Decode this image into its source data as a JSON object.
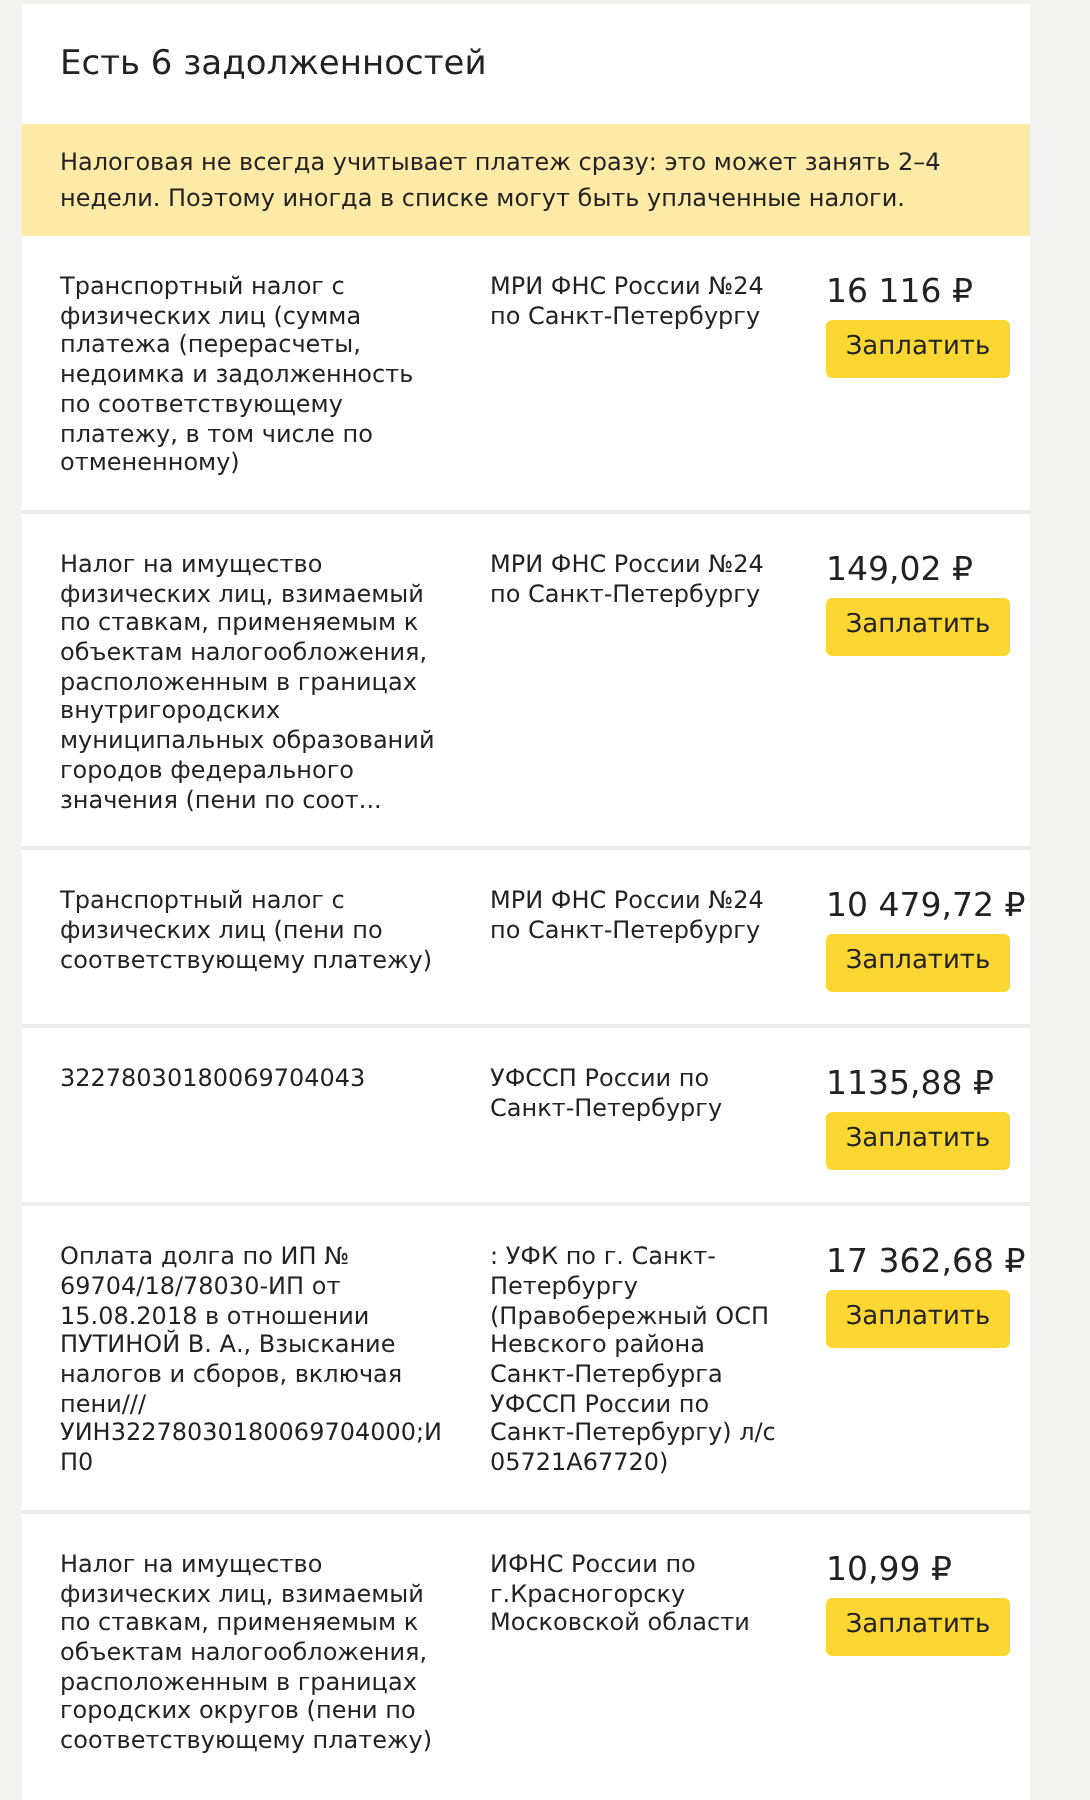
{
  "title": "Есть 6 задолженностей",
  "notice": "Налоговая не всегда учитывает платеж сразу: это может занять 2–4 недели. Поэтому иногда в списке могут быть уплаченные налоги.",
  "debts": [
    {
      "description": "Транспортный налог с физических лиц (сумма платежа (перерасчеты, недоимка и задолженность по соответствующему платежу, в том числе по отмененному)",
      "recipient": "МРИ ФНС России №24 по Санкт-Петербургу",
      "amount": "16 116 ₽",
      "button": "Заплатить"
    },
    {
      "description": "Налог на имущество физических лиц, взимаемый по ставкам, применяемым к объектам налогообложения, расположенным в границах внутригородских муниципальных образований городов федерального значения (пени по соот...",
      "recipient": "МРИ ФНС России №24 по Санкт-Петербургу",
      "amount": "149,02 ₽",
      "button": "Заплатить"
    },
    {
      "description": "Транспортный налог с физических лиц (пени по соответствующему платежу)",
      "recipient": "МРИ ФНС России №24 по Санкт-Петербургу",
      "amount": "10 479,72 ₽",
      "button": "Заплатить"
    },
    {
      "description": "32278030180069704043",
      "recipient": "УФССП России по Санкт-Петербургу",
      "amount": "1135,88 ₽",
      "button": "Заплатить"
    },
    {
      "description": "Оплата долга по ИП № 69704/18/78030-ИП от 15.08.2018 в отношении ПУТИНОЙ В. А., Взыскание налогов и сборов, включая пени/// УИН32278030180069704000;ИП0",
      "recipient": ": УФК по г. Санкт-Петербургу (Правобережный ОСП Невского района Санкт-Петербурга УФССП России по Санкт-Петербургу) л/с 05721А67720)",
      "amount": "17 362,68 ₽",
      "button": "Заплатить"
    },
    {
      "description": "Налог на имущество физических лиц, взимаемый по ставкам, применяемым к объектам налогообложения, расположенным в границах городских округов (пени по соответствующему платежу)",
      "recipient": "ИФНС России по г.Красногорску Московской области",
      "amount": "10,99 ₽",
      "button": "Заплатить"
    }
  ]
}
